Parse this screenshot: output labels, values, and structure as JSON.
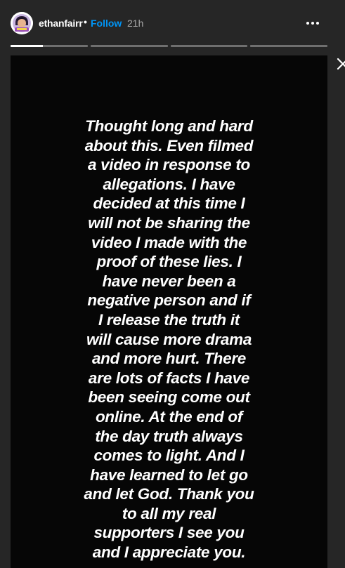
{
  "header": {
    "username": "ethanfairr",
    "separator": "•",
    "follow_label": "Follow",
    "timestamp": "21h",
    "avatar_icon": "profile-avatar-icon",
    "more_icon": "more-options-icon"
  },
  "progress": {
    "segment_count": 4,
    "active_index": 0,
    "active_progress": 0.42
  },
  "story": {
    "background_color": "#060606",
    "text": "Thought long and hard\nabout this. Even filmed\na video in response to\nallegations. I have\ndecided at this time I\nwill not be sharing the\nvideo I made with the\nproof of these lies. I\nhave never been a\nnegative person and if\nI release the truth it\nwill cause more drama\nand more hurt. There\nare lots of facts I have\nbeen seeing come out\nonline. At the end of\nthe day truth always\ncomes to light. And I\nhave learned to let go\nand let God. Thank you\nto all my real\nsupporters I see you\nand I appreciate you."
  },
  "controls": {
    "close_icon": "close-icon"
  },
  "colors": {
    "page_bg": "#262626",
    "accent": "#0095f6",
    "text": "#ffffff",
    "muted": "#a8a8a8"
  }
}
